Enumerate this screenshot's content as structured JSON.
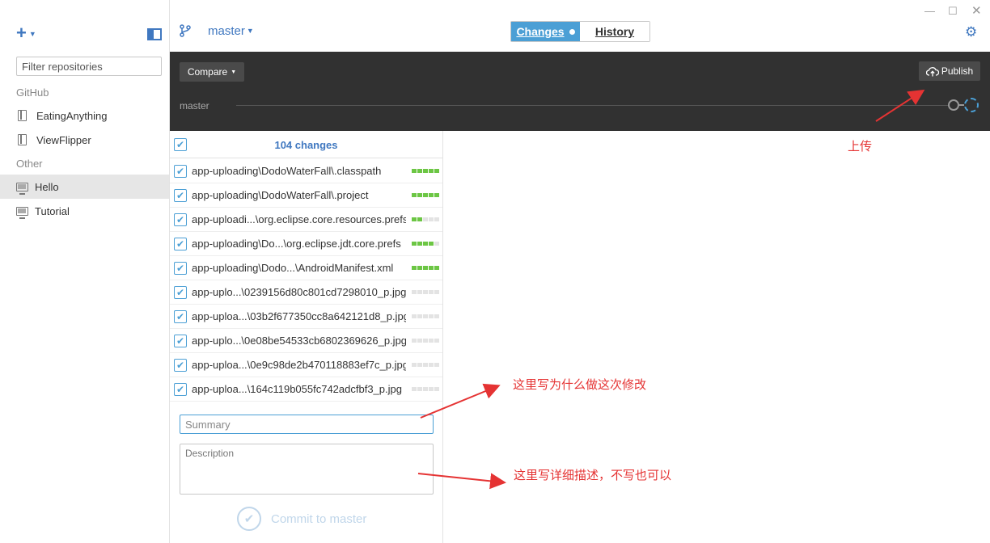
{
  "sidebar": {
    "add_icon": "plus-icon",
    "toggle_icon": "sidebar-toggle-icon",
    "filter_placeholder": "Filter repositories",
    "sections": [
      {
        "label": "GitHub",
        "items": [
          {
            "label": "EatingAnything",
            "icon": "repo-book-icon"
          },
          {
            "label": "ViewFlipper",
            "icon": "repo-book-icon"
          }
        ]
      },
      {
        "label": "Other",
        "items": [
          {
            "label": "Hello",
            "icon": "monitor-icon",
            "selected": true
          },
          {
            "label": "Tutorial",
            "icon": "monitor-icon"
          }
        ]
      }
    ]
  },
  "topbar": {
    "branch": "master",
    "tabs": {
      "changes": "Changes",
      "history": "History"
    },
    "active_tab": "Changes"
  },
  "darkbar": {
    "compare": "Compare",
    "publish": "Publish",
    "branch_label": "master"
  },
  "changes": {
    "count_label": "104 changes",
    "files": [
      {
        "name": "app-uploading\\DodoWaterFall\\.classpath",
        "bar": 5
      },
      {
        "name": "app-uploading\\DodoWaterFall\\.project",
        "bar": 5
      },
      {
        "name": "app-uploadi...\\org.eclipse.core.resources.prefs",
        "bar": 2
      },
      {
        "name": "app-uploading\\Do...\\org.eclipse.jdt.core.prefs",
        "bar": 4
      },
      {
        "name": "app-uploading\\Dodo...\\AndroidManifest.xml",
        "bar": 5
      },
      {
        "name": "app-uplo...\\0239156d80c801cd7298010_p.jpg",
        "bar": 0
      },
      {
        "name": "app-uploa...\\03b2f677350cc8a642121d8_p.jpg",
        "bar": 0
      },
      {
        "name": "app-uplo...\\0e08be54533cb6802369626_p.jpg",
        "bar": 0
      },
      {
        "name": "app-uploa...\\0e9c98de2b470118883ef7c_p.jpg",
        "bar": 0
      },
      {
        "name": "app-uploa...\\164c119b055fc742adcfbf3_p.jpg",
        "bar": 0
      }
    ],
    "summary_placeholder": "Summary",
    "description_placeholder": "Description",
    "commit_label": "Commit to master"
  },
  "annotations": {
    "publish_note": "上传",
    "summary_note": "这里写为什么做这次修改",
    "description_note": "这里写详细描述，不写也可以"
  },
  "colors": {
    "accent": "#4078c0",
    "tab_active": "#4b9fd5",
    "dark_bar": "#313131",
    "diff_bar": "#6cc644",
    "annotation": "#e53333"
  }
}
